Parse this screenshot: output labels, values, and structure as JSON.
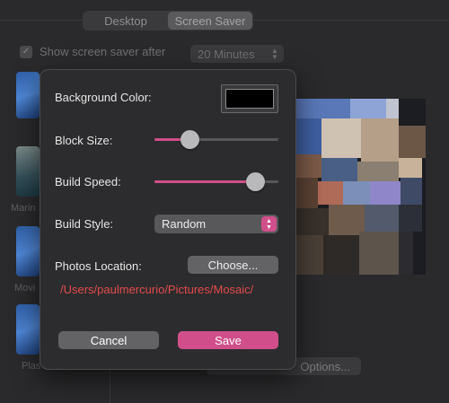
{
  "tabs": [
    {
      "label": "Desktop",
      "active": false
    },
    {
      "label": "Screen Saver",
      "active": true
    }
  ],
  "show_saver": {
    "checked": true,
    "label": "Show screen saver after",
    "value": "20 Minutes"
  },
  "savers": [
    {
      "label": "Marin"
    },
    {
      "label": "Movi"
    },
    {
      "label": "Plas"
    }
  ],
  "options_button": "Options...",
  "sheet": {
    "background_color": {
      "label": "Background Color:",
      "value": "#000000"
    },
    "block_size": {
      "label": "Block Size:",
      "value": 0.25
    },
    "build_speed": {
      "label": "Build Speed:",
      "value": 0.87
    },
    "build_style": {
      "label": "Build Style:",
      "value": "Random"
    },
    "photos_location": {
      "label": "Photos Location:",
      "button": "Choose...",
      "path": "/Users/paulmercurio/Pictures/Mosaic/"
    },
    "cancel": "Cancel",
    "save": "Save"
  },
  "colors": {
    "accent": "#d04f8a",
    "path_text": "#e34b4b"
  }
}
